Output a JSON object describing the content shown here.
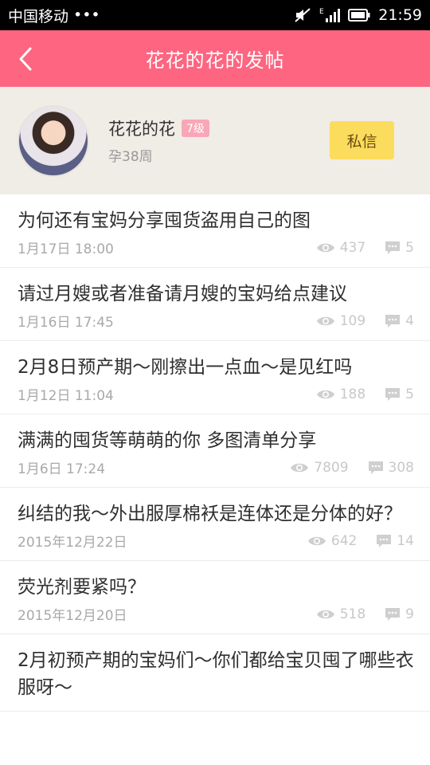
{
  "status_bar": {
    "carrier": "中国移动",
    "dots": "•••",
    "signal_label": "E",
    "time": "21:59"
  },
  "header": {
    "back_icon": "chevron-left-icon",
    "title": "花花的花的发帖",
    "colors": {
      "brand": "#fd6580"
    }
  },
  "profile": {
    "name": "花花的花",
    "level": "7级",
    "pregnancy": "孕38周",
    "message_button": "私信",
    "colors": {
      "message_button_bg": "#fcdc5c",
      "level_badge_bg": "#f9a7b6"
    }
  },
  "posts": [
    {
      "title": "为何还有宝妈分享囤货盗用自己的图",
      "date": "1月17日 18:00",
      "views": "437",
      "comments": "5"
    },
    {
      "title": "请过月嫂或者准备请月嫂的宝妈给点建议",
      "date": "1月16日 17:45",
      "views": "109",
      "comments": "4"
    },
    {
      "title": "2月8日预产期～刚擦出一点血～是见红吗",
      "date": "1月12日 11:04",
      "views": "188",
      "comments": "5"
    },
    {
      "title": "满满的囤货等萌萌的你  多图清单分享",
      "date": "1月6日 17:24",
      "views": "7809",
      "comments": "308"
    },
    {
      "title": "纠结的我～外出服厚棉袄是连体还是分体的好？",
      "date": "2015年12月22日",
      "views": "642",
      "comments": "14"
    },
    {
      "title": "荧光剂要紧吗？",
      "date": "2015年12月20日",
      "views": "518",
      "comments": "9"
    },
    {
      "title": "2月初预产期的宝妈们～你们都给宝贝囤了哪些衣服呀～",
      "date": "",
      "views": "",
      "comments": ""
    }
  ]
}
